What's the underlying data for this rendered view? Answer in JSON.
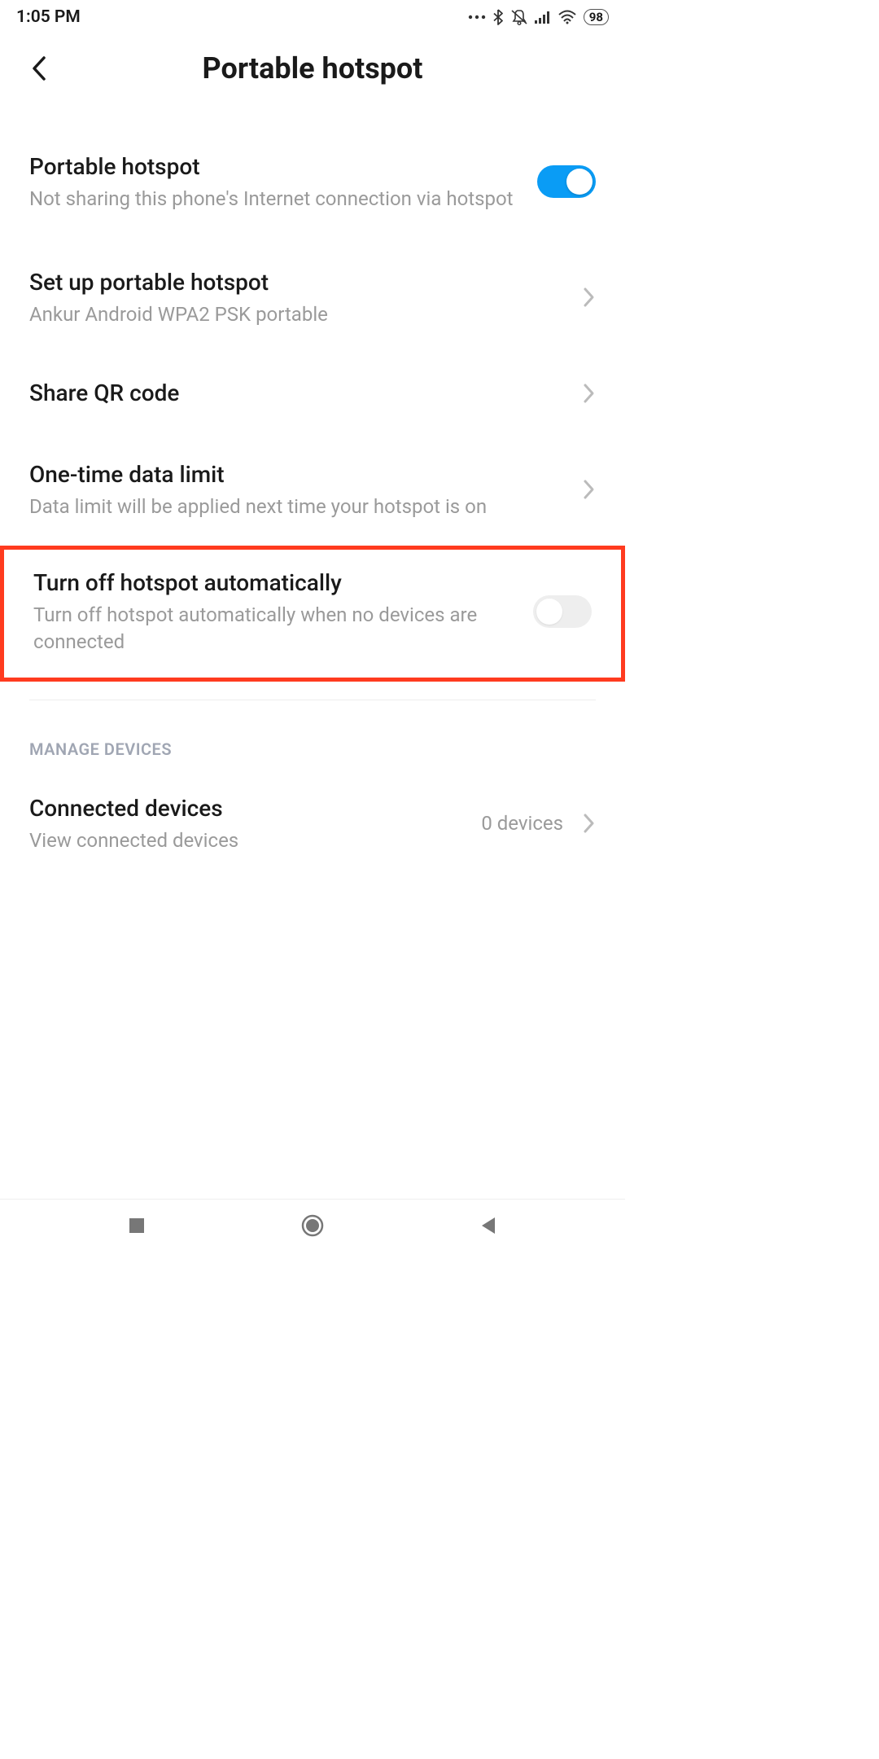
{
  "status": {
    "time": "1:05 PM",
    "battery": "98"
  },
  "header": {
    "title": "Portable hotspot"
  },
  "settings": {
    "hotspot": {
      "title": "Portable hotspot",
      "sub": "Not sharing this phone's Internet connection via hotspot",
      "on": true
    },
    "setup": {
      "title": "Set up portable hotspot",
      "sub": "Ankur Android WPA2 PSK portable"
    },
    "qr": {
      "title": "Share QR code"
    },
    "datalimit": {
      "title": "One-time data limit",
      "sub": "Data limit will be applied next time your hotspot is on"
    },
    "autooff": {
      "title": "Turn off hotspot automatically",
      "sub": "Turn off hotspot automatically when no devices are connected",
      "on": false
    }
  },
  "manage": {
    "header": "MANAGE DEVICES",
    "connected": {
      "title": "Connected devices",
      "sub": "View connected devices",
      "value": "0 devices"
    }
  }
}
